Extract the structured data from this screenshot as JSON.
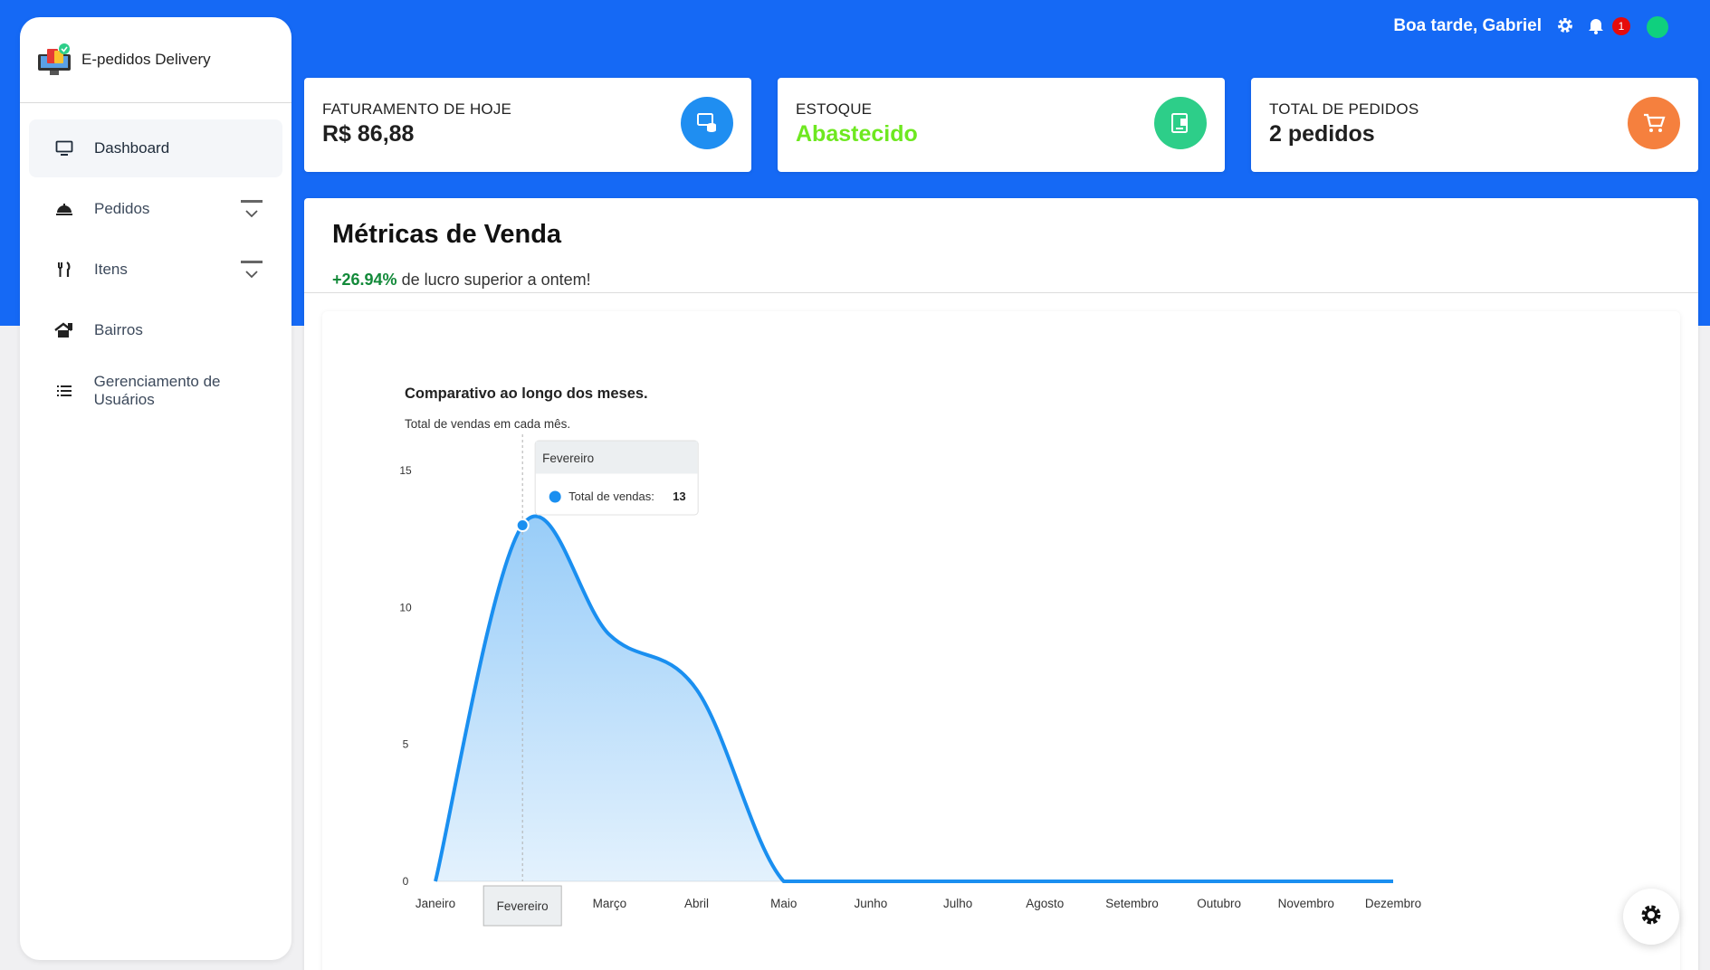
{
  "brand": {
    "name": "E-pedidos Delivery"
  },
  "sidebar": {
    "items": [
      {
        "label": "Dashboard",
        "icon": "monitor-icon",
        "active": true
      },
      {
        "label": "Pedidos",
        "icon": "service-bell-icon",
        "expandable": true
      },
      {
        "label": "Itens",
        "icon": "utensils-icon",
        "expandable": true
      },
      {
        "label": "Bairros",
        "icon": "house-icon"
      },
      {
        "label": "Gerenciamento de Usuários",
        "icon": "list-icon"
      }
    ]
  },
  "header": {
    "greeting": "Boa tarde, Gabriel",
    "notification_count": "1",
    "status_color": "#0fd07e"
  },
  "cards": [
    {
      "title": "FATURAMENTO DE HOJE",
      "value": "R$ 86,88",
      "icon": "money-stack-icon",
      "color": "#1f8ef1"
    },
    {
      "title": "ESTOQUE",
      "value": "Abastecido",
      "icon": "stock-icon",
      "color": "#2dce89"
    },
    {
      "title": "TOTAL DE PEDIDOS",
      "value": "2 pedidos",
      "icon": "cart-icon",
      "color": "#f5803e"
    }
  ],
  "metrics": {
    "title": "Métricas de Venda",
    "growth": "+26.94%",
    "growth_text": " de lucro superior a ontem!"
  },
  "chart_data": {
    "type": "area",
    "title": "Comparativo ao longo dos meses.",
    "subtitle": "Total de vendas em cada mês.",
    "categories": [
      "Janeiro",
      "Fevereiro",
      "Março",
      "Abril",
      "Maio",
      "Junho",
      "Julho",
      "Agosto",
      "Setembro",
      "Outubro",
      "Novembro",
      "Dezembro"
    ],
    "series": [
      {
        "name": "Total de vendas",
        "values": [
          0,
          13,
          9,
          7,
          0,
          0,
          0,
          0,
          0,
          0,
          0,
          0
        ]
      }
    ],
    "ylim": [
      0,
      15
    ],
    "yticks": [
      0,
      5,
      10,
      15
    ],
    "color": "#1a8ff0",
    "tooltip": {
      "category": "Fevereiro",
      "label": "Total de vendas:",
      "value": "13"
    }
  }
}
